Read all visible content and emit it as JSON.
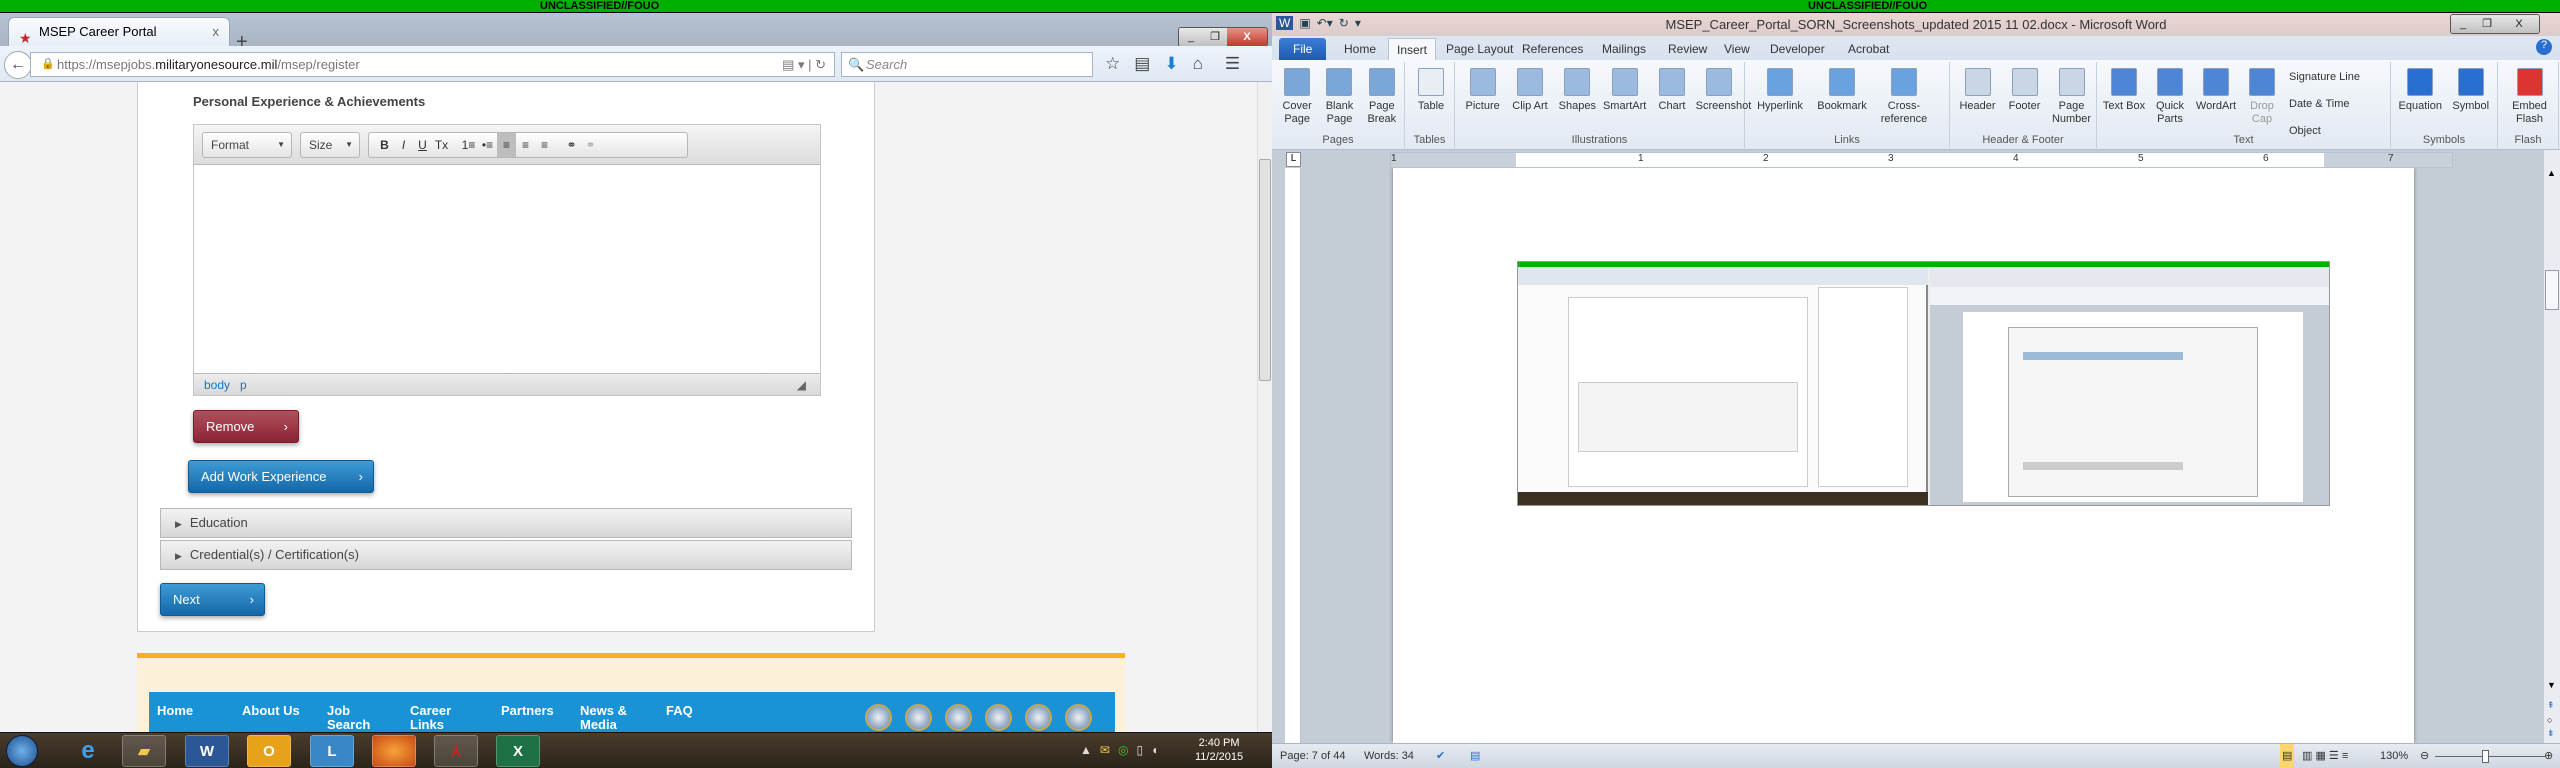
{
  "classification": {
    "left": "UNCLASSIFIED//FOUO",
    "right": "UNCLASSIFIED//FOUO"
  },
  "browser": {
    "tab_title": "MSEP Career Portal",
    "new_tab": "+",
    "url_prefix": "https://msepjobs.",
    "url_domain": "militaryonesource.mil",
    "url_path": "/msep/register",
    "search_placeholder": "Search"
  },
  "page": {
    "section_heading": "Personal Experience & Achievements",
    "editor": {
      "format": "Format",
      "size": "Size",
      "buttons": [
        "B",
        "I",
        "U",
        "Tx",
        "1≡",
        "•≡",
        "≡",
        "≡",
        "≡",
        "⚭",
        "⚭"
      ],
      "path": [
        "body",
        "p"
      ]
    },
    "remove_label": "Remove",
    "add_work_label": "Add Work Experience",
    "accordion": [
      "Education",
      "Credential(s) / Certification(s)"
    ],
    "next_label": "Next",
    "footer_links": [
      "Home",
      "About Us",
      "Job Search",
      "Career Links",
      "Partners",
      "News & Media",
      "FAQ"
    ]
  },
  "taskbar": {
    "time": "2:40 PM",
    "date": "11/2/2015",
    "apps": [
      "IE",
      "Explorer",
      "Word",
      "Outlook",
      "Lync",
      "Firefox",
      "Acrobat",
      "Excel"
    ]
  },
  "word": {
    "title": "MSEP_Career_Portal_SORN_Screenshots_updated 2015 11 02.docx - Microsoft Word",
    "tabs": [
      "File",
      "Home",
      "Insert",
      "Page Layout",
      "References",
      "Mailings",
      "Review",
      "View",
      "Developer",
      "Acrobat"
    ],
    "active_tab": "Insert",
    "groups": [
      {
        "label": "Pages",
        "buttons": [
          "Cover Page",
          "Blank Page",
          "Page Break"
        ]
      },
      {
        "label": "Tables",
        "buttons": [
          "Table"
        ]
      },
      {
        "label": "Illustrations",
        "buttons": [
          "Picture",
          "Clip Art",
          "Shapes",
          "SmartArt",
          "Chart",
          "Screenshot"
        ]
      },
      {
        "label": "Links",
        "buttons": [
          "Hyperlink",
          "Bookmark",
          "Cross-reference"
        ]
      },
      {
        "label": "Header & Footer",
        "buttons": [
          "Header",
          "Footer",
          "Page Number"
        ]
      },
      {
        "label": "Text",
        "buttons": [
          "Text Box",
          "Quick Parts",
          "WordArt",
          "Drop Cap"
        ],
        "small": [
          "Signature Line",
          "Date & Time",
          "Object"
        ]
      },
      {
        "label": "Symbols",
        "buttons": [
          "Equation",
          "Symbol"
        ]
      },
      {
        "label": "Flash",
        "buttons": [
          "Embed Flash"
        ]
      }
    ],
    "ruler_numbers": [
      "1",
      "1",
      "2",
      "3",
      "4",
      "5",
      "6",
      "7"
    ],
    "status": {
      "page": "Page: 7 of 44",
      "words": "Words: 34",
      "zoom": "130%"
    }
  }
}
